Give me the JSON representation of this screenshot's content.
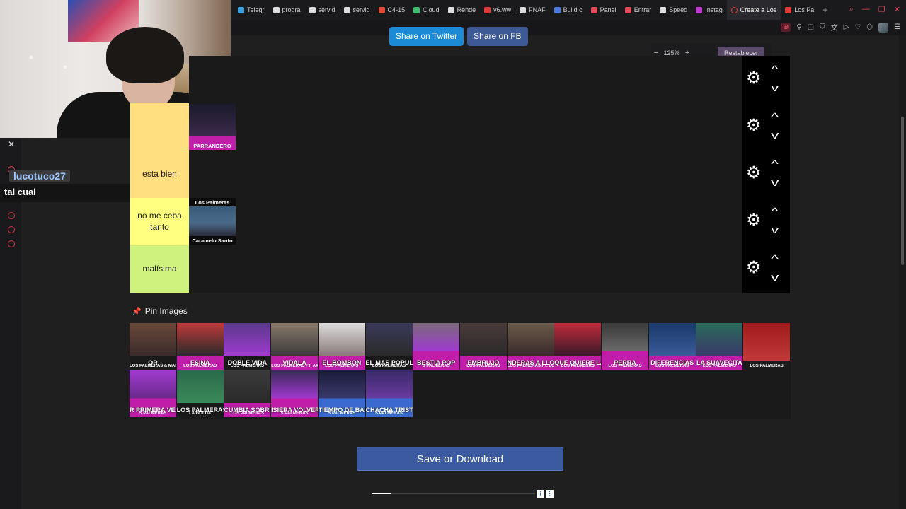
{
  "browser": {
    "tabs": [
      {
        "label": "Telegr"
      },
      {
        "label": "progra"
      },
      {
        "label": "servid"
      },
      {
        "label": "servid"
      },
      {
        "label": "C4-15"
      },
      {
        "label": "Cloud"
      },
      {
        "label": "Rende"
      },
      {
        "label": "v6.ww"
      },
      {
        "label": "FNAF"
      },
      {
        "label": "Build c"
      },
      {
        "label": "Panel"
      },
      {
        "label": "Entrar"
      },
      {
        "label": "Speed"
      },
      {
        "label": "Instag"
      },
      {
        "label": "Create a Los"
      },
      {
        "label": "Los Pa"
      }
    ],
    "active_tab": "Create a Los",
    "new_tab": "+"
  },
  "chat": {
    "close": "✕",
    "user": "lucotuco27",
    "message": "tal cual"
  },
  "share": {
    "twitter": "Share on Twitter",
    "fb": "Share on FB"
  },
  "zoom": {
    "minus": "−",
    "value": "125%",
    "plus": "+",
    "reset": "Restablecer"
  },
  "tiers": [
    {
      "label": "",
      "color": "#1f1f1f",
      "items": []
    },
    {
      "label": "",
      "color": "#ffdf80",
      "items": [
        {
          "caption": "PARRANDERO"
        }
      ]
    },
    {
      "label": "esta bien",
      "color": "#ffdf80",
      "items": []
    },
    {
      "label": "no me ceba tanto",
      "color": "#ffff80",
      "items": [
        {
          "caption_top": "Los Palmeras",
          "caption": "Caramelo Santo"
        }
      ]
    },
    {
      "label": "malísima",
      "color": "#cff27f",
      "items": []
    }
  ],
  "pin": {
    "title": "Pin Images"
  },
  "pool": [
    {
      "cap": "OR",
      "sub": "LOS PALMERAS & MARCELA MORELO"
    },
    {
      "cap": "ESINA",
      "sub": "LOS PALMERAS"
    },
    {
      "cap": "DOBLE VIDA",
      "sub": "LOS PALMERAS"
    },
    {
      "cap": "VIDALA",
      "sub": "LOS PALMERAS FT. AXEL"
    },
    {
      "cap": "EL BOMBON",
      "sub": "LOS PALMERAS"
    },
    {
      "cap": "EL MAS POPULAR",
      "sub": "LOS PALMERAS"
    },
    {
      "cap": "BESTIA POP",
      "sub": "S PALMERAS"
    },
    {
      "cap": "EMBRUJO",
      "sub": "LOS PALMERAS"
    },
    {
      "cap": "NDERAS A LLOR",
      "sub": "LOS PALMERAS FT. LOS NOCHE"
    },
    {
      "cap": "QUE QUIERE LA CHOLA",
      "sub": "LOS PALMERAS"
    },
    {
      "cap": "PERRA",
      "sub": "LOS PALMERAS"
    },
    {
      "cap": "DIFERENCIAS",
      "sub": "LOS PALMERAS"
    },
    {
      "cap": "LA SUAVECITA",
      "sub": "LOS PALMERAS"
    },
    {
      "cap": "",
      "sub": "LOS PALMERAS"
    },
    {
      "cap": "R PRIMERA VEZ",
      "sub": "S PALMERAS"
    },
    {
      "cap": "LOS PALMERAS",
      "sub": "LA GOLDA"
    },
    {
      "cap": "CUMBIA SOBRE EL MAR",
      "sub": "LOS PALMERAS"
    },
    {
      "cap": "ISIERA VOLVER",
      "sub": "S PALMERAS"
    },
    {
      "cap": "TIEMPO DE BAIL",
      "sub": "S PALMERAS"
    },
    {
      "cap": "CHACHA TRISTE",
      "sub": "S PALMERAS"
    }
  ],
  "save": "Save or Download",
  "colors": {
    "accent": "#3b5aa0",
    "twitter": "#1d8ad6",
    "fb": "#3d5a96",
    "tier_yellow": "#ffdf80",
    "tier_lightyellow": "#ffff80",
    "tier_green": "#cff27f"
  }
}
